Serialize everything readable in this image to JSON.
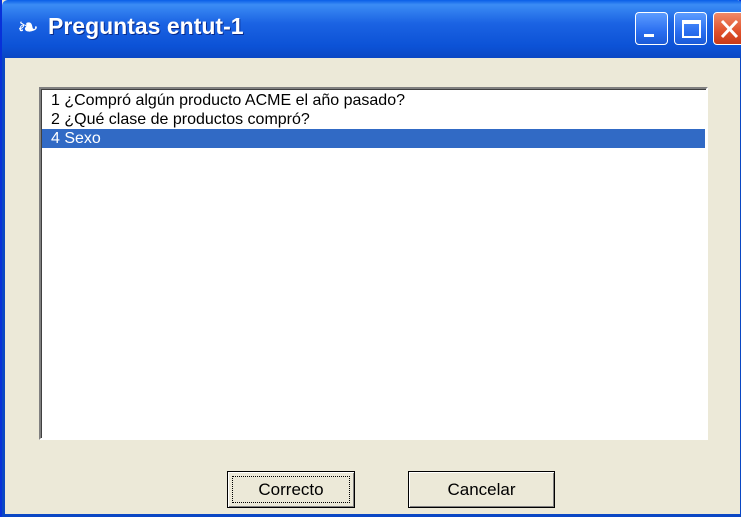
{
  "window": {
    "title": "Preguntas entut-1",
    "icon": "app-icon"
  },
  "titlebar_buttons": {
    "minimize_icon": "minimize-icon",
    "maximize_icon": "maximize-icon",
    "close_icon": "close-icon"
  },
  "list": {
    "items": [
      {
        "label": "1  ¿Compró algún producto ACME el año pasado?",
        "selected": false
      },
      {
        "label": "2  ¿Qué clase de productos compró?",
        "selected": false
      },
      {
        "label": "4  Sexo",
        "selected": true
      }
    ]
  },
  "buttons": {
    "ok_label": "Correcto",
    "cancel_label": "Cancelar"
  },
  "colors": {
    "titlebar": "#0c52d6",
    "selection": "#316ac5",
    "dialog_bg": "#ece9d8",
    "close_button": "#e0502a"
  }
}
